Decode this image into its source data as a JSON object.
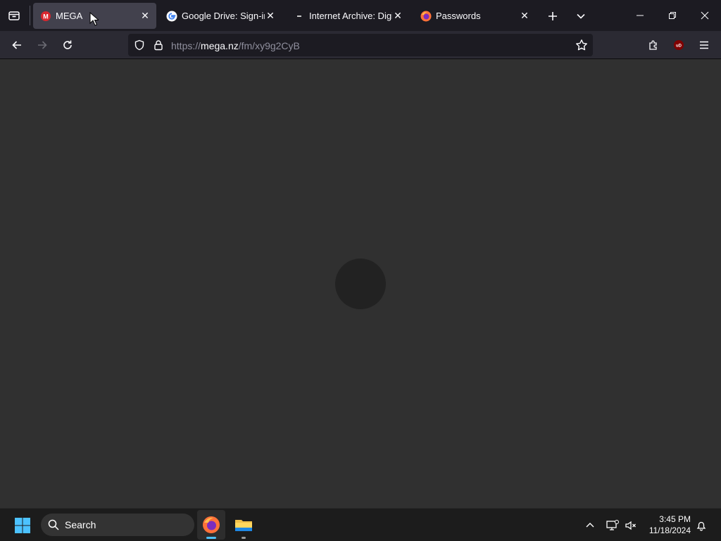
{
  "browser": {
    "tabs": [
      {
        "title": "MEGA",
        "favicon": "mega-icon",
        "active": true
      },
      {
        "title": "Google Drive: Sign-in",
        "favicon": "google-icon",
        "active": false
      },
      {
        "title": "Internet Archive: Digital Library",
        "favicon": "internet-archive-icon",
        "active": false
      },
      {
        "title": "Passwords",
        "favicon": "firefox-icon",
        "active": false
      }
    ],
    "url_prefix": "https://",
    "url_host": "mega.nz",
    "url_path": "/fm/xy9g2CyB"
  },
  "page": {
    "state": "loading",
    "spinner": "loading-spinner"
  },
  "taskbar": {
    "search_label": "Search",
    "time": "3:45 PM",
    "date": "11/18/2024",
    "pinned": [
      "firefox-icon",
      "file-explorer-icon"
    ]
  },
  "colors": {
    "tab_bar": "#1c1b22",
    "toolbar": "#2b2a33",
    "content_bg": "#303030",
    "spinner": "#222222",
    "mega_red": "#d9272e",
    "taskbar": "#1c1c1c"
  }
}
